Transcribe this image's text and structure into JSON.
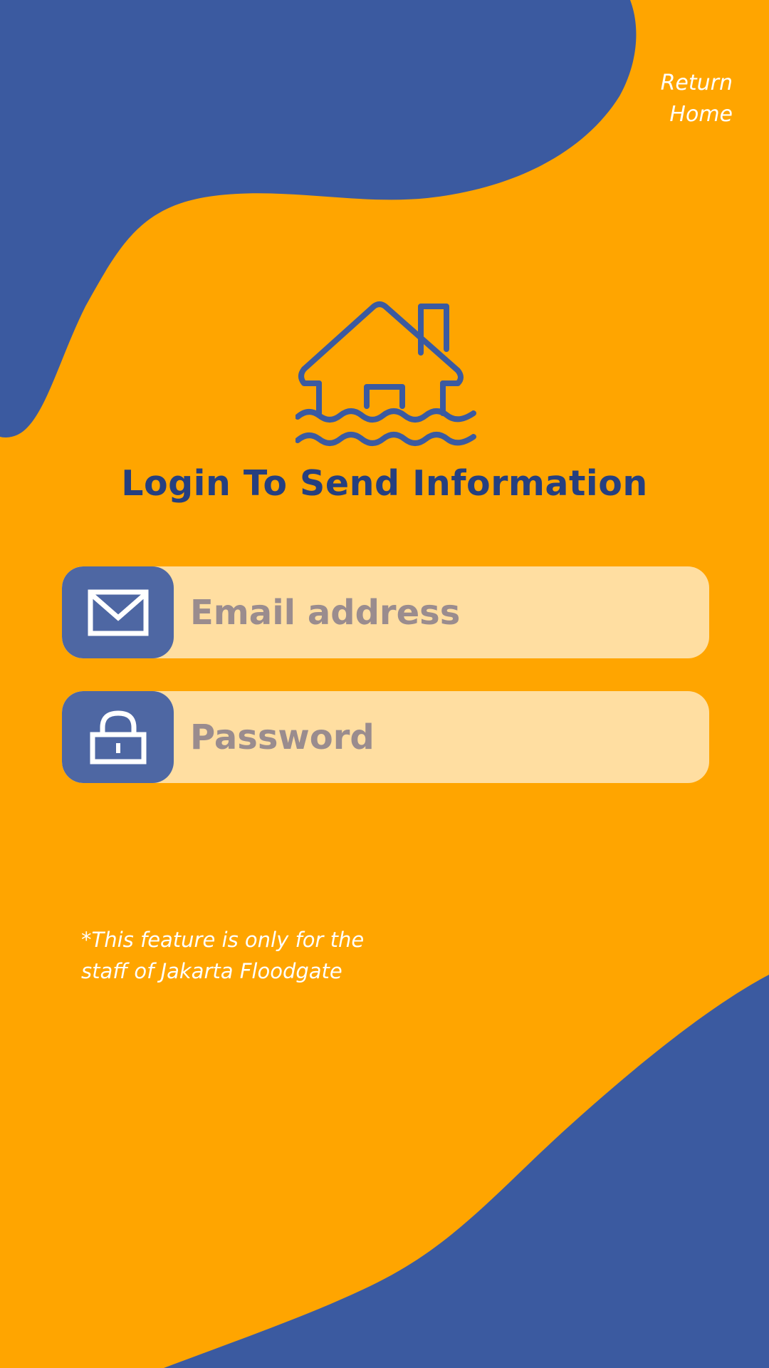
{
  "colors": {
    "background": "#FFA500",
    "blob": "#3B5AA0",
    "title": "#253F7F",
    "field_bg": "#FFDEA1",
    "icon_box": "#4E67A3",
    "placeholder": "#9A8C8E",
    "white": "#FFFFFF"
  },
  "header": {
    "return_home_line1": "Return",
    "return_home_line2": "Home"
  },
  "hero": {
    "icon": "house-flood-icon",
    "title": "Login To Send Information"
  },
  "form": {
    "email": {
      "icon": "envelope-icon",
      "placeholder": "Email address",
      "value": ""
    },
    "password": {
      "icon": "lock-icon",
      "placeholder": "Password",
      "value": ""
    }
  },
  "footer": {
    "disclaimer_line1": "*This feature is only for the",
    "disclaimer_line2": "staff of Jakarta Floodgate"
  }
}
